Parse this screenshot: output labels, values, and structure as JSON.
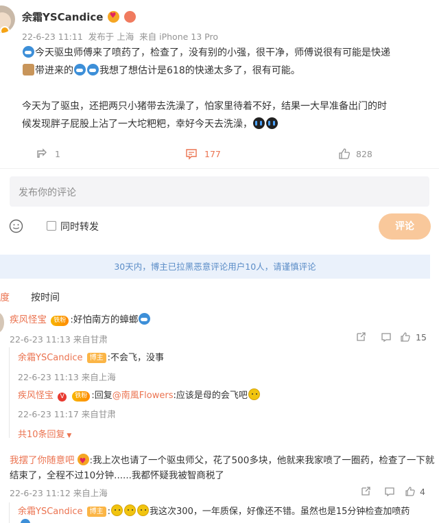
{
  "post": {
    "author": "余霜YSCandice",
    "meta": "22-6-23 11:11  发布于 上海  来自 iPhone 13 Pro",
    "text_p1_a": "今天驱虫师傅来了喷药了，检查了，没有别的小强，很干净，师傅说很有可能是快递",
    "text_p1_b": "带进来的",
    "text_p1_c": "我想了想估计是618的快递太多了，很有可能。",
    "text_p2_a": "今天为了驱虫，还把两只小猪带去洗澡了，怕家里待着不好，结果一大早准备出门的时",
    "text_p2_b": "候发现胖子屁股上沾了一大坨粑粑，幸好今天去洗澡，",
    "repost_count": "1",
    "comment_count": "177",
    "like_count": "828"
  },
  "composer": {
    "placeholder": "发布你的评论",
    "repost_label": "同时转发",
    "submit_label": "评论"
  },
  "notice": "30天内，博主已拉黑恶意评论用户10人，请谨慎评论",
  "sort": {
    "heat_label": "度",
    "time_label": "按时间"
  },
  "comments": [
    {
      "user": "疾风怪宝",
      "badge": "铁粉",
      "text": ":好怕南方的蟑螂",
      "meta": "22-6-23 11:13 来自甘肃",
      "likes": "15",
      "replies": [
        {
          "user": "余霜YSCandice",
          "badge": "博主",
          "text": ":不会飞，没事",
          "meta": "22-6-23 11:13 来自上海"
        },
        {
          "user": "疾风怪宝",
          "badge": "铁粉",
          "text_a": ":回复",
          "mention": "@南風Flowers",
          "text_b": ":应该是母的会飞吧",
          "meta": "22-6-23 11:17 来自甘肃"
        }
      ],
      "more_replies": "共10条回复"
    },
    {
      "user": "我摆了你随意吧",
      "text_a": ":我上次也请了一个驱虫师父，花了500多块，他就来我家喷了一圈药，检查了一下就",
      "text_b": "结束了，全程不过10分钟......我都怀疑我被智商税了",
      "meta": "22-6-23 11:12 来自上海",
      "likes": "4",
      "replies": [
        {
          "user": "余霜YSCandice",
          "badge": "博主",
          "text": "我这次300，一年质保，好像还不错。虽然也是15分钟检查加喷药"
        }
      ]
    }
  ],
  "colors": {
    "accent": "#eb7350",
    "submit_bg": "#f9c89b",
    "notice_bg": "#eaf1fb",
    "notice_text": "#5a8cc7"
  },
  "icons": [
    "repost-icon",
    "comment-icon",
    "like-icon",
    "emoji-icon",
    "report-icon"
  ]
}
